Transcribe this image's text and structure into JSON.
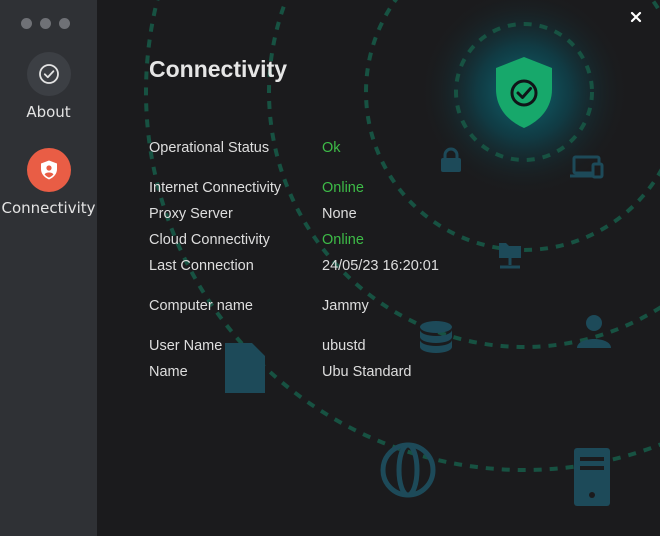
{
  "sidebar": {
    "items": [
      {
        "label": "About",
        "icon": "check-circle-icon",
        "selected": false
      },
      {
        "label": "Connectivity",
        "icon": "shield-user-icon",
        "selected": true
      }
    ]
  },
  "page": {
    "title": "Connectivity",
    "rows": [
      {
        "label": "Operational Status",
        "value": "Ok",
        "status": "good"
      },
      {
        "label": "Internet Connectivity",
        "value": "Online",
        "status": "good"
      },
      {
        "label": "Proxy Server",
        "value": "None",
        "status": "neutral"
      },
      {
        "label": "Cloud Connectivity",
        "value": "Online",
        "status": "good"
      },
      {
        "label": "Last Connection",
        "value": "24/05/23 16:20:01",
        "status": "neutral"
      },
      {
        "label": "Computer name",
        "value": "Jammy",
        "status": "neutral"
      },
      {
        "label": "User Name",
        "value": "ubustd",
        "status": "neutral"
      },
      {
        "label": "Name",
        "value": "Ubu Standard",
        "status": "neutral"
      }
    ]
  },
  "colors": {
    "accent": "#e95d45",
    "status_ok": "#3dbb47",
    "shield": "#17a86b",
    "background_icons": "#1d4a59"
  }
}
